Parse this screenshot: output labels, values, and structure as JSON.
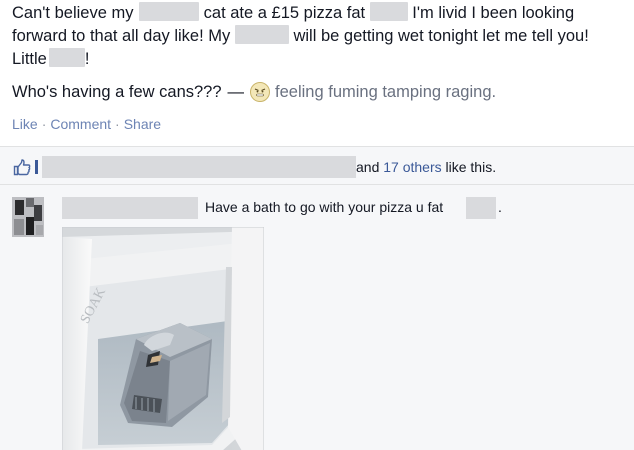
{
  "post": {
    "line1_a": "Can't believe my",
    "line1_b": "cat ate a £15 pizza fat",
    "line1_c": "I'm livid I been looking",
    "line2_a": "forward to that all day like! My",
    "line2_b": "will be getting wet tonight let me tell you!",
    "line3_a": "Little",
    "line3_b": "!",
    "status": "Who's having a few cans???",
    "dash": "—",
    "feeling_text": "feeling fuming tamping raging.",
    "feeling_icon": "angry-face-icon"
  },
  "actions": {
    "like": "Like",
    "comment": "Comment",
    "share": "Share",
    "separator": "·"
  },
  "likes": {
    "and": "and",
    "others": "17 others",
    "suffix": "like this.",
    "icon": "thumbs-up-icon"
  },
  "comment": {
    "text": "Have a bath to go with your pizza u fat",
    "end": "."
  },
  "colors": {
    "link": "#3b5998",
    "action_link": "#6d84b4",
    "redaction": "#d9dadd",
    "ufi_background": "#f6f7f9"
  }
}
